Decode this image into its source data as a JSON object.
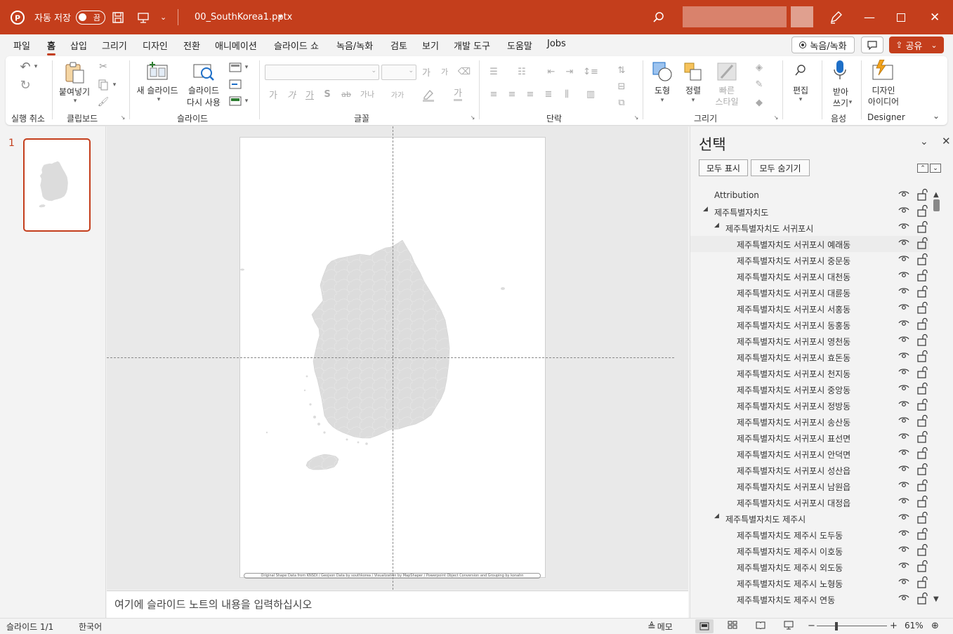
{
  "titlebar": {
    "autosave_label": "자동 저장",
    "autosave_state": "끔",
    "filename": "00_SouthKorea1.pptx"
  },
  "tabs": [
    "파일",
    "홈",
    "삽입",
    "그리기",
    "디자인",
    "전환",
    "애니메이션",
    "슬라이드 쇼",
    "녹음/녹화",
    "검토",
    "보기",
    "개발 도구",
    "도움말",
    "Jobs"
  ],
  "tabs_right": {
    "record": "녹음/녹화",
    "share": "공유"
  },
  "ribbon": {
    "undo_group": "실행 취소",
    "paste": "붙여넣기",
    "clipboard_group": "클립보드",
    "new_slide": "새 슬라이드",
    "reuse_slides_1": "슬라이드",
    "reuse_slides_2": "다시 사용",
    "slides_group": "슬라이드",
    "font_group": "글꼴",
    "paragraph_group": "단락",
    "shapes": "도형",
    "arrange": "정렬",
    "quick_styles_1": "빠른",
    "quick_styles_2": "스타일",
    "drawing_group": "그리기",
    "editing": "편집",
    "dictate_1": "받아",
    "dictate_2": "쓰기",
    "voice_group": "음성",
    "designer_1": "디자인",
    "designer_2": "아이디어",
    "designer_group": "Designer",
    "font_glyphs": {
      "grow": "가",
      "shrink": "가",
      "bold": "가",
      "italic": "가",
      "underline": "가",
      "strike": "S",
      "spacing": "ab",
      "case": "가나",
      "hangul": "가가",
      "highlight": "가"
    }
  },
  "thumbnail": {
    "number": "1"
  },
  "slide": {
    "attribution": "Original Shape Data from KNSDI / Geojson Data by southkorea / Visualization by MapShaper / Powerpoint Object Conversion and Grouping by konahn"
  },
  "notes_placeholder": "여기에 슬라이드 노트의 내용을 입력하십시오",
  "selection_pane": {
    "title": "선택",
    "show_all": "모두 표시",
    "hide_all": "모두 숨기기",
    "items": [
      {
        "label": "Attribution",
        "level": 0,
        "toggle": false
      },
      {
        "label": "제주특별자치도",
        "level": 0,
        "toggle": true
      },
      {
        "label": "제주특별자치도 서귀포시",
        "level": 1,
        "toggle": true
      },
      {
        "label": "제주특별자치도 서귀포시 예래동",
        "level": 2,
        "toggle": false
      },
      {
        "label": "제주특별자치도 서귀포시 중문동",
        "level": 2,
        "toggle": false
      },
      {
        "label": "제주특별자치도 서귀포시 대천동",
        "level": 2,
        "toggle": false
      },
      {
        "label": "제주특별자치도 서귀포시 대륜동",
        "level": 2,
        "toggle": false
      },
      {
        "label": "제주특별자치도 서귀포시 서홍동",
        "level": 2,
        "toggle": false
      },
      {
        "label": "제주특별자치도 서귀포시 동홍동",
        "level": 2,
        "toggle": false
      },
      {
        "label": "제주특별자치도 서귀포시 영천동",
        "level": 2,
        "toggle": false
      },
      {
        "label": "제주특별자치도 서귀포시 효돈동",
        "level": 2,
        "toggle": false
      },
      {
        "label": "제주특별자치도 서귀포시 천지동",
        "level": 2,
        "toggle": false
      },
      {
        "label": "제주특별자치도 서귀포시 중앙동",
        "level": 2,
        "toggle": false
      },
      {
        "label": "제주특별자치도 서귀포시 정방동",
        "level": 2,
        "toggle": false
      },
      {
        "label": "제주특별자치도 서귀포시 송산동",
        "level": 2,
        "toggle": false
      },
      {
        "label": "제주특별자치도 서귀포시 표선면",
        "level": 2,
        "toggle": false
      },
      {
        "label": "제주특별자치도 서귀포시 안덕면",
        "level": 2,
        "toggle": false
      },
      {
        "label": "제주특별자치도 서귀포시 성산읍",
        "level": 2,
        "toggle": false
      },
      {
        "label": "제주특별자치도 서귀포시 남원읍",
        "level": 2,
        "toggle": false
      },
      {
        "label": "제주특별자치도 서귀포시 대정읍",
        "level": 2,
        "toggle": false
      },
      {
        "label": "제주특별자치도 제주시",
        "level": 1,
        "toggle": true
      },
      {
        "label": "제주특별자치도 제주시 도두동",
        "level": 2,
        "toggle": false
      },
      {
        "label": "제주특별자치도 제주시 이호동",
        "level": 2,
        "toggle": false
      },
      {
        "label": "제주특별자치도 제주시 외도동",
        "level": 2,
        "toggle": false
      },
      {
        "label": "제주특별자치도 제주시 노형동",
        "level": 2,
        "toggle": false
      },
      {
        "label": "제주특별자치도 제주시 연동",
        "level": 2,
        "toggle": false
      }
    ]
  },
  "statusbar": {
    "slide_count": "슬라이드 1/1",
    "language": "한국어",
    "notes": "메모",
    "zoom": "61%"
  },
  "colors": {
    "accent": "#c43e1c"
  }
}
